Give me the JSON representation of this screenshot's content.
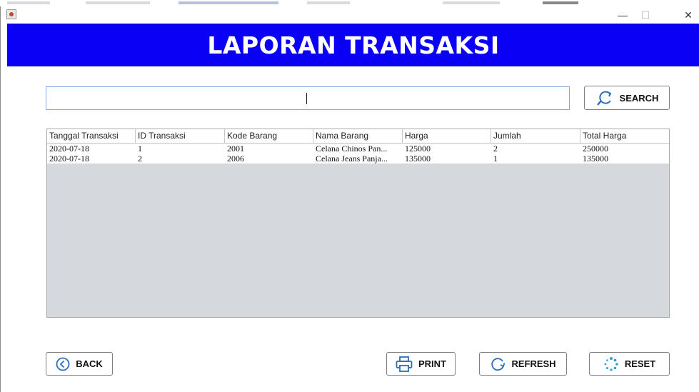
{
  "window": {
    "header_title": "LAPORAN TRANSAKSI",
    "controls": {
      "minimize": "—",
      "maximize": "☐",
      "close": "✕"
    }
  },
  "search": {
    "value": "",
    "placeholder": "",
    "button_label": "SEARCH"
  },
  "table": {
    "columns": [
      "Tanggal Transaksi",
      "ID Transaksi",
      "Kode Barang",
      "Nama Barang",
      "Harga",
      "Jumlah",
      "Total Harga"
    ],
    "rows": [
      [
        "2020-07-18",
        "1",
        "2001",
        "Celana Chinos Pan...",
        "125000",
        "2",
        "250000"
      ],
      [
        "2020-07-18",
        "2",
        "2006",
        "Celana Jeans Panja...",
        "135000",
        "1",
        "135000"
      ]
    ]
  },
  "buttons": {
    "back": "BACK",
    "print": "PRINT",
    "refresh": "REFRESH",
    "reset": "RESET"
  },
  "colors": {
    "header_bg": "#0a00f5",
    "table_empty_bg": "#d5d8dd",
    "input_border": "#86a9d8",
    "icon_blue": "#2a6fb8"
  },
  "icons": {
    "search": "search-refresh-icon",
    "back": "circle-left-arrow-icon",
    "print": "printer-icon",
    "refresh": "refresh-circle-icon",
    "reset": "spinner-dots-icon"
  }
}
